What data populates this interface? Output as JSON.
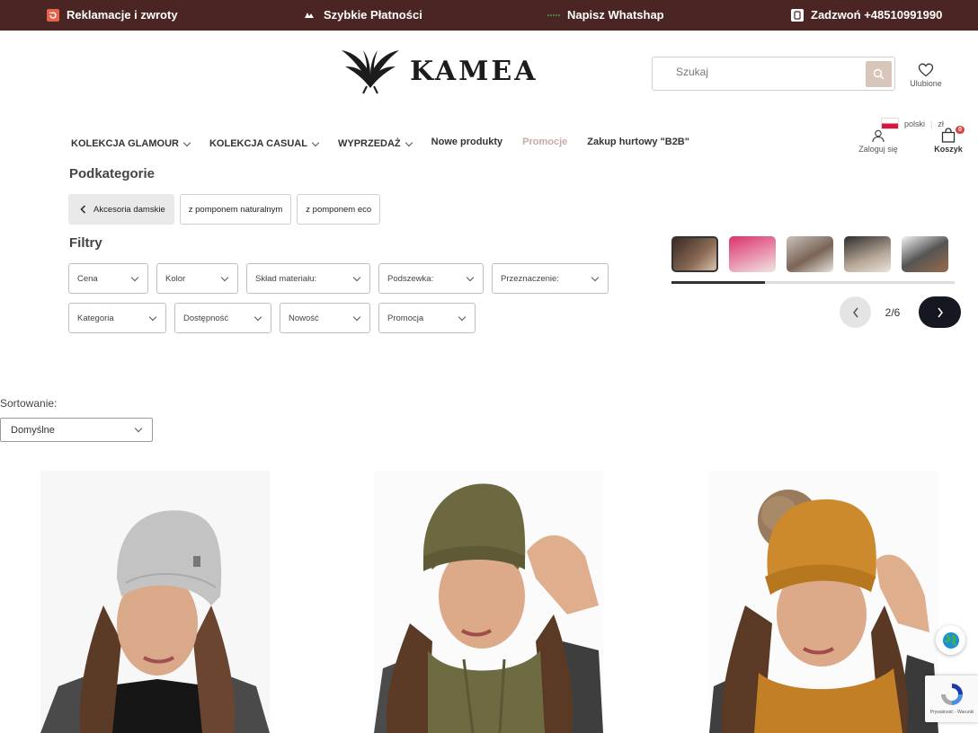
{
  "topbar": {
    "returns": "Reklamacje i zwroty",
    "payments": "Szybkie Płatności",
    "whatsapp": "Napisz Whatshap",
    "call": "Zadzwoń +48510991990"
  },
  "header": {
    "logo": "KAMEA",
    "search_placeholder": "Szukaj",
    "favorites": "Ulubione",
    "language": "polski",
    "currency": "zł",
    "login": "Zaloguj się",
    "cart": "Koszyk",
    "cart_count": "0"
  },
  "nav": {
    "items": [
      {
        "label": "KOLEKCJA GLAMOUR"
      },
      {
        "label": "KOLEKCJA CASUAL"
      },
      {
        "label": "WYPRZEDAŻ"
      },
      {
        "label": "Nowe produkty"
      },
      {
        "label": "Promocje"
      },
      {
        "label": "Zakup hurtowy \"B2B\""
      }
    ]
  },
  "subcategories": {
    "title": "Podkategorie",
    "back": "Akcesoria damskie",
    "items": [
      "z pomponem naturalnym",
      "z pomponem eco"
    ]
  },
  "filters": {
    "title": "Filtry",
    "row1": [
      "Cena",
      "Kolor",
      "Skład materiału:",
      "Podszewka:",
      "Przeznaczenie:"
    ],
    "row2": [
      "Kategoria",
      "Dostępność",
      "Nowość",
      "Promocja"
    ]
  },
  "slider": {
    "page": "2/6",
    "progress": 0.33
  },
  "sorting": {
    "label": "Sortowanie:",
    "value": "Domyślne"
  },
  "recaptcha": "Prywatność - Warunki",
  "colors": {
    "topbar": "#4a2524",
    "accent": "#d8c6bb",
    "promo": "#c6aba3",
    "cart_badge": "#d9453e"
  }
}
